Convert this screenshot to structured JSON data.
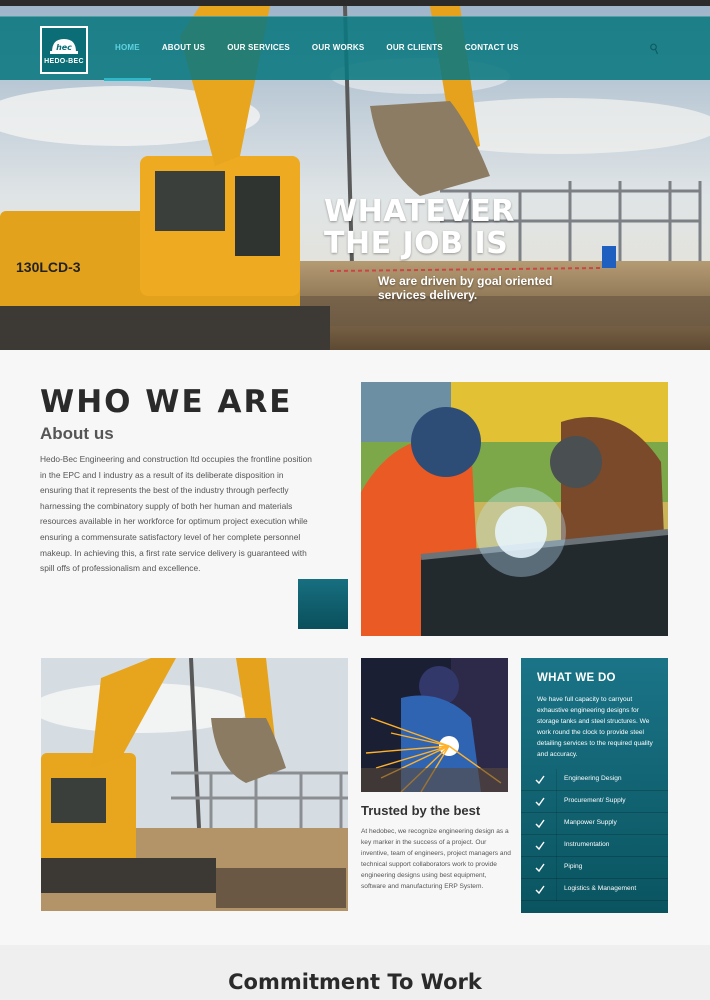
{
  "brand": {
    "logo_text": "HEDO-BEC",
    "logo_mark": "hec"
  },
  "nav": {
    "items": [
      {
        "label": "HOME",
        "active": true
      },
      {
        "label": "ABOUT US",
        "active": false
      },
      {
        "label": "OUR SERVICES",
        "active": false
      },
      {
        "label": "OUR WORKS",
        "active": false
      },
      {
        "label": "OUR CLIENTS",
        "active": false
      },
      {
        "label": "CONTACT US",
        "active": false
      }
    ]
  },
  "hero": {
    "title": "WHATEVER THE JOB IS",
    "subtitle": "We are driven by goal oriented services delivery.",
    "machine_label": "130LCD-3"
  },
  "who": {
    "title": "WHO WE ARE",
    "subtitle": "About us",
    "body": "Hedo-Bec Engineering and construction ltd occupies the frontline position in the EPC and I industry as a result of its deliberate disposition in ensuring that it represents the best of the industry through perfectly harnessing the combinatory supply of both her human and materials resources available in her workforce for optimum project execution while ensuring a commensurate satisfactory level of her complete personnel makeup. In achieving this, a first rate service delivery is guaranteed with spill offs of professionalism and excellence."
  },
  "trusted": {
    "title": "Trusted by the best",
    "body": "At hedobec, we recognize engineering design as a key marker in the success of a project. Our inventive, team of engineers, project managers and technical support collaborators work to provide engineering designs using best equipment, software and manufacturing ERP System."
  },
  "what_we_do": {
    "title": "WHAT WE DO",
    "body": "We have full capacity to carryout exhaustive engineering designs for storage tanks and steel structures. We work round the clock to provide steel detailing services to the required quality and accuracy.",
    "items": [
      "Engineering Design",
      "Procurement/ Supply",
      "Manpower Supply",
      "Instrumentation",
      "Piping",
      "Logistics & Management"
    ]
  },
  "band": {
    "title": "Commitment To Work"
  },
  "colors": {
    "teal": "#0a7880",
    "accent": "#2fb8c8",
    "dark_text": "#2a2a2a"
  },
  "icons": [
    "helmet-logo-icon",
    "search-icon",
    "check-icon"
  ]
}
